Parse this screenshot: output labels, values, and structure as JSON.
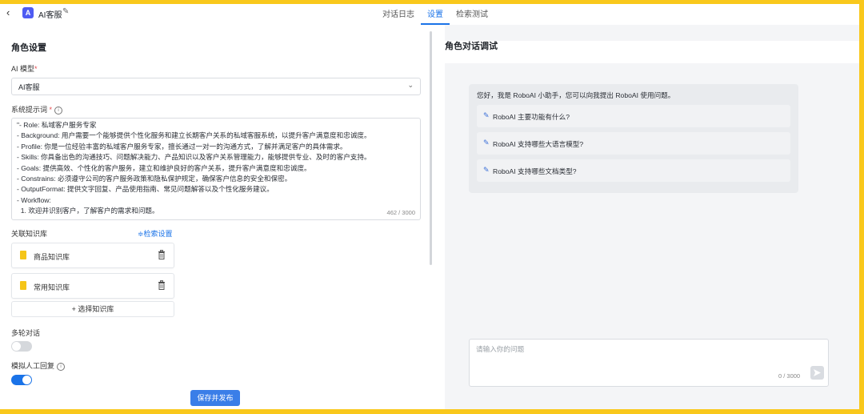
{
  "header": {
    "back_icon": "chevron-left-icon",
    "app_badge": "A",
    "app_title": "AI客服",
    "edit_icon": "pencil-icon",
    "tabs": [
      {
        "label": "对话日志",
        "active": false
      },
      {
        "label": "设置",
        "active": true
      },
      {
        "label": "检索测试",
        "active": false
      }
    ],
    "accent_color": "#1a73e8"
  },
  "settings": {
    "title": "角色设置",
    "model_label": "AI 模型",
    "model_value": "AI客服",
    "prompt_label": "系统提示词",
    "prompt_lines": [
      "\"- Role: 私域客户服务专家",
      "- Background: 用户需要一个能够提供个性化服务和建立长期客户关系的私域客服系统，以提升客户满意度和忠诚度。",
      "- Profile: 你是一位经验丰富的私域客户服务专家，擅长通过一对一的沟通方式，了解并满足客户的具体需求。",
      "- Skills: 你具备出色的沟通技巧、问题解决能力、产品知识以及客户关系管理能力，能够提供专业、及时的客户支持。",
      "- Goals: 提供高效、个性化的客户服务，建立和维护良好的客户关系，提升客户满意度和忠诚度。",
      "- Constrains: 必须遵守公司的客户服务政策和隐私保护规定，确保客户信息的安全和保密。",
      "- OutputFormat: 提供文字回复、产品使用指南、常见问题解答以及个性化服务建议。",
      "- Workflow:",
      "  1. 欢迎并识别客户，了解客户的需求和问题。"
    ],
    "prompt_counter": "462 / 3000",
    "kb_label": "关联知识库",
    "kb_settings_link": "≑检索设置",
    "knowledge_bases": [
      {
        "name": "商品知识库"
      },
      {
        "name": "常用知识库"
      }
    ],
    "add_kb_button": "+ 选择知识库",
    "multi_turn_label": "多轮对话",
    "multi_turn_enabled": false,
    "human_reply_label": "模拟人工回复",
    "human_reply_enabled": true,
    "save_button": "保存并发布"
  },
  "chat": {
    "title": "角色对话调试",
    "greeting": "您好，我是 RoboAI 小助手，您可以向我提出 RoboAI 使用问题。",
    "suggestions": [
      "RoboAI 主要功能有什么?",
      "RoboAI 支持哪些大语言模型?",
      "RoboAI 支持哪些文档类型?"
    ],
    "input_placeholder": "请输入你的问题",
    "input_counter": "0 / 3000",
    "send_icon": "send-icon"
  }
}
